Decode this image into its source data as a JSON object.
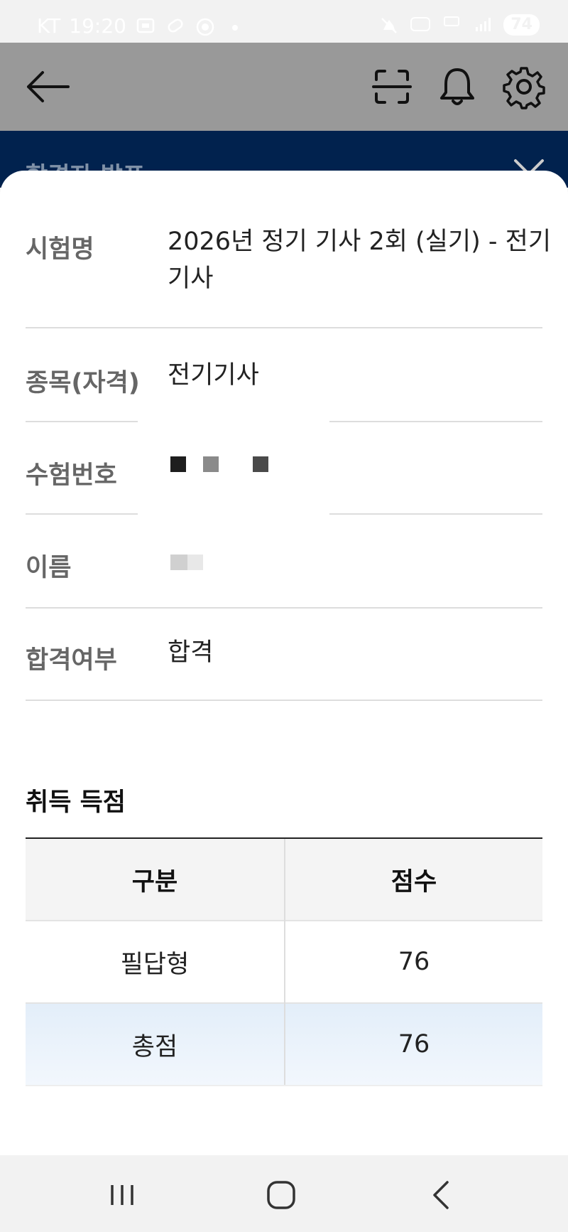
{
  "status_bar": {
    "carrier": "KT",
    "time": "19:20",
    "battery": "74",
    "icons": [
      "screenshot-icon",
      "link-icon",
      "record-icon",
      "dot-icon",
      "mute-icon",
      "hd-icon",
      "5g-icon",
      "signal-icon"
    ]
  },
  "app_bar": {
    "icons": [
      "back-arrow-icon",
      "scan-icon",
      "bell-icon",
      "gear-icon"
    ]
  },
  "banner": {
    "title": "합격자 발표"
  },
  "details": {
    "exam_label": "시험명",
    "exam_value": "2026년 정기 기사 2회 (실기) - 전기기사",
    "subject_label": "종목(자격)",
    "subject_value": "전기기사",
    "number_label": "수험번호",
    "name_label": "이름",
    "result_label": "합격여부",
    "result_value": "합격"
  },
  "scores": {
    "title": "취득 득점",
    "columns": [
      "구분",
      "점수"
    ],
    "rows": [
      {
        "category": "필답형",
        "score": "76"
      },
      {
        "category": "총점",
        "score": "76"
      }
    ]
  },
  "colors": {
    "banner": "#01224e",
    "app_bar": "#999999",
    "highlight_row": "#e6f0fa"
  },
  "nav_bar": {
    "icons": [
      "recent-apps-icon",
      "home-icon",
      "back-icon"
    ]
  }
}
